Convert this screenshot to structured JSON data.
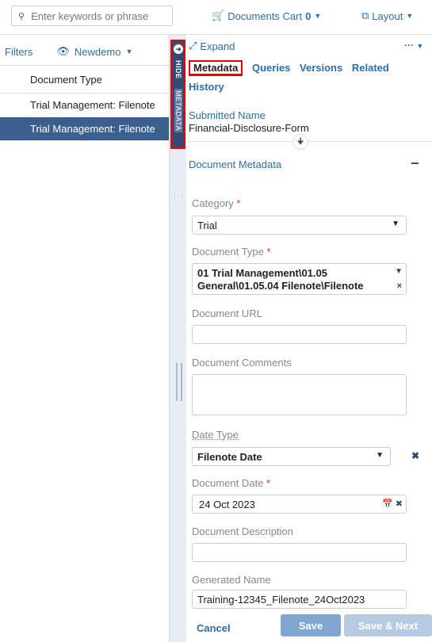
{
  "topbar": {
    "search_placeholder": "Enter keywords or phrase",
    "search_icon": "search-icon",
    "cart_label": "Documents Cart",
    "cart_count": "0",
    "layout_label": "Layout"
  },
  "left": {
    "filters_label": "Filters",
    "view_label": "Newdemo",
    "column_header": "Document Type",
    "rows": [
      "Trial Management: Filenote",
      "Trial Management: Filenote"
    ]
  },
  "strip": {
    "hide_label": "HIDE",
    "metadata_label": "METADATA"
  },
  "right": {
    "expand_label": "Expand",
    "more_label": "···",
    "tabs": [
      "Metadata",
      "Queries",
      "Versions",
      "Related",
      "History"
    ],
    "submitted_name_label": "Submitted Name",
    "submitted_name_value": "Financial-Disclosure-Form",
    "section_title": "Document Metadata",
    "section_toggle": "−"
  },
  "fields": {
    "category_label": "Category",
    "category_value": "Trial",
    "doctype_label": "Document Type",
    "doctype_value_line1": "01 Trial Management\\01.05",
    "doctype_value_line2": "General\\01.05.04 Filenote\\Filenote",
    "docurl_label": "Document URL",
    "docurl_value": "",
    "comments_label": "Document Comments",
    "comments_value": "",
    "datetype_label": "Date Type",
    "datetype_value": "Filenote Date",
    "docdate_label": "Document Date",
    "docdate_value": "24 Oct 2023",
    "description_label": "Document Description",
    "description_value": "",
    "generated_label": "Generated Name",
    "generated_value": "Training-12345_Filenote_24Oct2023",
    "required_mark": "*"
  },
  "buttons": {
    "cancel": "Cancel",
    "save": "Save",
    "save_next": "Save & Next"
  }
}
